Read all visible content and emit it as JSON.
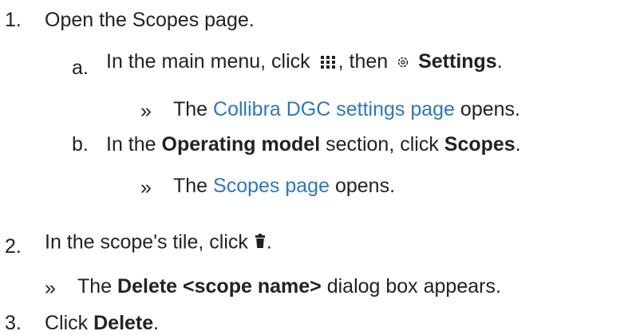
{
  "steps": [
    {
      "number": "1.",
      "text": "Open the Scopes page.",
      "substeps": [
        {
          "letter": "a.",
          "pre": "In the main menu, click",
          "mid": ", then",
          "bold": "Settings",
          "post": ".",
          "result": {
            "marker": "»",
            "pre": "The",
            "link": "Collibra DGC settings page",
            "post": "opens."
          }
        },
        {
          "letter": "b.",
          "pre": "In the",
          "bold1": "Operating model",
          "mid": "section, click",
          "bold2": "Scopes",
          "post": ".",
          "result": {
            "marker": "»",
            "pre": "The",
            "link": "Scopes page",
            "post": "opens."
          }
        }
      ]
    },
    {
      "number": "2.",
      "pre": "In the scope's tile, click",
      "post": ".",
      "result": {
        "marker": "»",
        "pre": "The",
        "bold": "Delete <scope name>",
        "post": "dialog box appears."
      }
    },
    {
      "number": "3.",
      "pre": "Click",
      "bold": "Delete",
      "post": "."
    }
  ],
  "icons": {
    "main_menu": "grid-menu-icon",
    "settings": "gear-icon",
    "delete": "trash-icon"
  },
  "colors": {
    "text": "#222222",
    "link": "#2a77c6"
  }
}
